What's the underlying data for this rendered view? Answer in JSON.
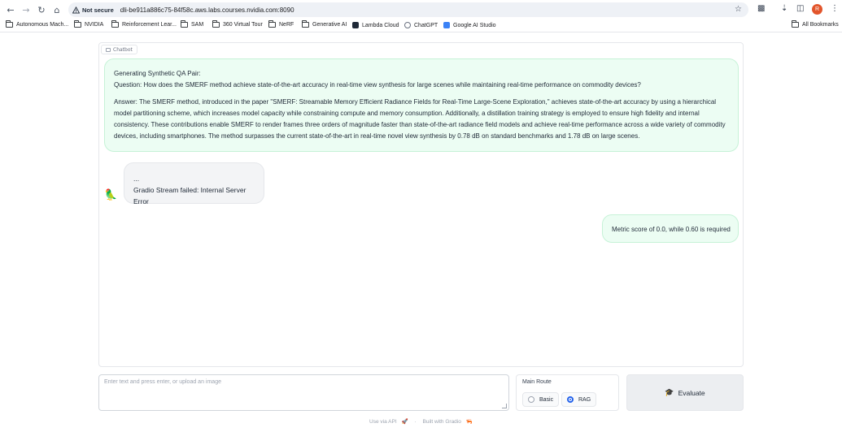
{
  "browser": {
    "security_label": "Not secure",
    "url": "dli-be911a886c75-84f58c.aws.labs.courses.nvidia.com:8090",
    "avatar_letter": "R"
  },
  "bookmarks": {
    "items": [
      {
        "label": "Autonomous Mach...",
        "icon": "folder-icon"
      },
      {
        "label": "NVIDIA",
        "icon": "folder-icon"
      },
      {
        "label": "Reinforcement Lear...",
        "icon": "folder-icon"
      },
      {
        "label": "SAM",
        "icon": "folder-icon"
      },
      {
        "label": "360 Virtual Tour",
        "icon": "folder-icon"
      },
      {
        "label": "NeRF",
        "icon": "folder-icon"
      },
      {
        "label": "Generative AI",
        "icon": "folder-icon"
      },
      {
        "label": "Lambda Cloud",
        "icon": "lambda-icon"
      },
      {
        "label": "ChatGPT",
        "icon": "chatgpt-icon"
      },
      {
        "label": "Google AI Studio",
        "icon": "google-ai-studio-icon"
      }
    ],
    "all_bookmarks": "All Bookmarks"
  },
  "chatbot": {
    "label": "Chatbot",
    "messages": [
      {
        "role": "bot",
        "line1": "Generating Synthetic QA Pair:",
        "line2": "Question: How does the SMERF method achieve state-of-the-art accuracy in real-time view synthesis for large scenes while maintaining real-time performance on commodity devices?",
        "answer": "Answer: The SMERF method, introduced in the paper \"SMERF: Streamable Memory Efficient Radiance Fields for Real-Time Large-Scene Exploration,\" achieves state-of-the-art accuracy by using a hierarchical model partitioning scheme, which increases model capacity while constraining compute and memory consumption. Additionally, a distillation training strategy is employed to ensure high fidelity and internal consistency. These contributions enable SMERF to render frames three orders of magnitude faster than state-of-the-art radiance field models and achieve real-time performance across a wide variety of commodity devices, including smartphones. The method surpasses the current state-of-the-art in real-time novel view synthesis by 0.78 dB on standard benchmarks and 1.78 dB on large scenes."
      },
      {
        "role": "bot",
        "line1": "...",
        "line2": "Gradio Stream failed: Internal Server Error"
      },
      {
        "role": "user",
        "text": "Metric score of 0.0, while 0.60 is required"
      }
    ]
  },
  "input": {
    "placeholder": "Enter text and press enter, or upload an image"
  },
  "route": {
    "title": "Main Route",
    "options": [
      "Basic",
      "RAG"
    ],
    "selected": "RAG"
  },
  "evaluate_button": {
    "label": "Evaluate"
  },
  "footer": {
    "api_label": "Use via API",
    "separator": "·",
    "built_label": "Built with Gradio"
  },
  "colors": {
    "bot_bubble": "#ecfdf3",
    "error_bubble": "#f3f4f6",
    "radio_accent": "#2563eb",
    "avatar": "#e2552b"
  }
}
